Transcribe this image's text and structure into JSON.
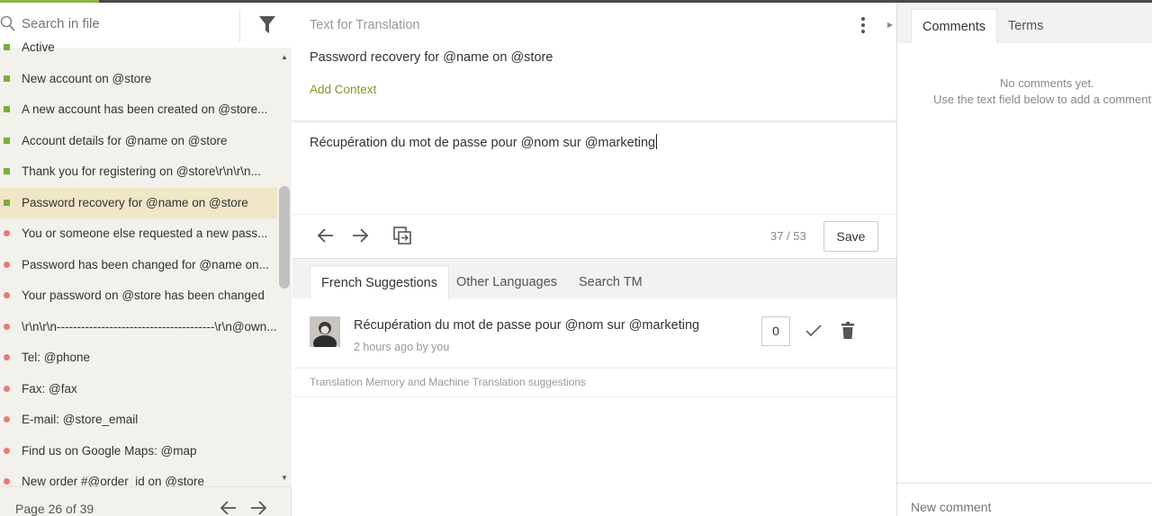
{
  "search": {
    "placeholder": "Search in file"
  },
  "strings": [
    {
      "text": "Active",
      "status": "translated"
    },
    {
      "text": "New account on @store",
      "status": "translated"
    },
    {
      "text": "A new account has been created on @store...",
      "status": "translated"
    },
    {
      "text": "Account details for @name on @store",
      "status": "translated"
    },
    {
      "text": "Thank you for registering on @store\\r\\n\\r\\n...",
      "status": "translated"
    },
    {
      "text": "Password recovery for @name on @store",
      "status": "translated",
      "active": true
    },
    {
      "text": "You or someone else requested a new pass...",
      "status": "untranslated"
    },
    {
      "text": "Password has been changed for @name on...",
      "status": "untranslated"
    },
    {
      "text": "Your password on @store has been changed",
      "status": "untranslated"
    },
    {
      "text": "\\r\\n\\r\\n---------------------------------------\\r\\n@own...",
      "status": "untranslated"
    },
    {
      "text": "Tel: @phone",
      "status": "untranslated"
    },
    {
      "text": "Fax: @fax",
      "status": "untranslated"
    },
    {
      "text": "E-mail: @store_email",
      "status": "untranslated"
    },
    {
      "text": "Find us on Google Maps: @map",
      "status": "untranslated"
    },
    {
      "text": "New order #@order_id on @store",
      "status": "untranslated"
    }
  ],
  "pager": {
    "label": "Page 26 of 39"
  },
  "editor": {
    "source_label": "Text for Translation",
    "source_text": "Password recovery for @name on @store",
    "add_context": "Add Context",
    "translation": "Récupération du mot de passe pour @nom sur @marketing",
    "counter": "37 / 53",
    "save_label": "Save"
  },
  "suggestions": {
    "tabs": [
      "French Suggestions",
      "Other Languages",
      "Search TM"
    ],
    "items": [
      {
        "text": "Récupération du mot de passe pour @nom sur @marketing",
        "meta": "2 hours ago by you",
        "votes": "0"
      }
    ],
    "tm_label": "Translation Memory and Machine Translation suggestions"
  },
  "sidebar_right": {
    "tabs": [
      "Comments",
      "Terms"
    ],
    "empty_line1": "No comments yet.",
    "empty_line2": "Use the text field below to add a comment.",
    "new_comment_placeholder": "New comment"
  },
  "colors": {
    "translated": "#7bad3b",
    "untranslated": "#e77a7a",
    "accent": "#7a9a2a",
    "active_row": "#f0e6c8"
  }
}
